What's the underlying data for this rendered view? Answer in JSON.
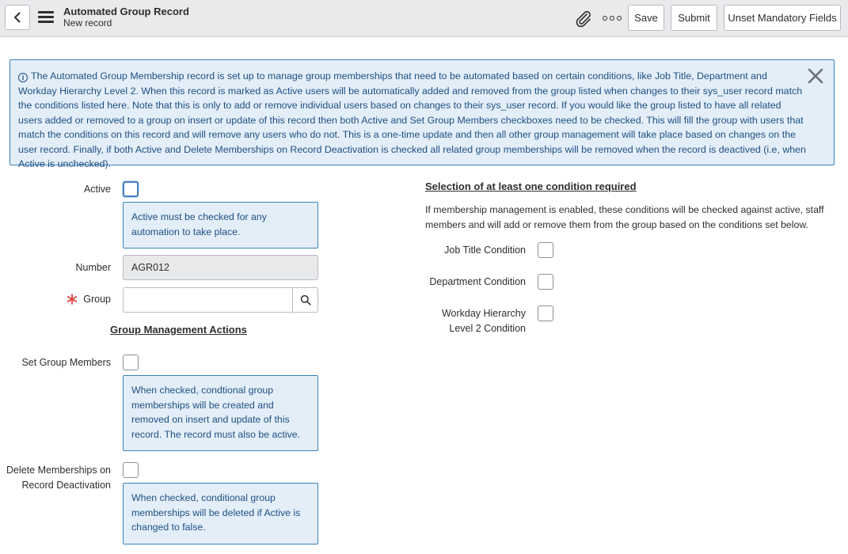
{
  "header": {
    "title": "Automated Group Record",
    "subtitle": "New record",
    "buttons": {
      "save": "Save",
      "submit": "Submit",
      "unset": "Unset Mandatory Fields"
    }
  },
  "banner": {
    "text": "The Automated Group Membership record is set up to manage group memberships that need to be automated based on certain conditions, like Job Title, Department and Workday Hierarchy Level 2. When this record is marked as Active users will be automatically added and removed from the group listed when changes to their sys_user record match the conditions listed here. Note that this is only to add or remove individual users based on changes to their sys_user record. If you would like the group listed to have all related users added or removed to a group on insert or update of this record then both Active and Set Group Members checkboxes need to be checked. This will fill the group with users that match the conditions on this record and will remove any users who do not. This is a one-time update and then all other group management will take place based on changes on the user record. Finally, if both Active and Delete Memberships on Record Deactivation is checked all related group memberships will be removed when the record is deactived (i.e, when Active is unchecked)."
  },
  "form": {
    "active": {
      "label": "Active",
      "checked": false,
      "note": "Active must be checked for any automation to take place."
    },
    "number": {
      "label": "Number",
      "value": "AGR012"
    },
    "group": {
      "label": "Group",
      "value": "",
      "required": true
    },
    "group_actions_heading": "Group Management Actions",
    "set_group_members": {
      "label": "Set Group Members",
      "checked": false,
      "note": "When checked, condtional group memberships will be created and removed on insert and update of this record. The record must also be active."
    },
    "delete_memberships": {
      "label_line1": "Delete Memberships on",
      "label_line2": "Record Deactivation",
      "checked": false,
      "note": "When checked, conditional group memberships will be deleted if Active is changed to false."
    }
  },
  "conditions": {
    "heading": "Selection of at least one condition required",
    "description": "If membership management is enabled, these conditions will be checked against active, staff members and will add or remove them from the group based on the conditions set below.",
    "job_title": {
      "label": "Job Title Condition",
      "checked": false
    },
    "department": {
      "label": "Department Condition",
      "checked": false
    },
    "workday": {
      "label_line1": "Workday Hierarchy",
      "label_line2": "Level 2 Condition",
      "checked": false
    }
  },
  "icons": [
    "back-icon",
    "menu-icon",
    "paperclip-icon",
    "more-icon",
    "info-icon",
    "close-icon",
    "search-icon",
    "required-icon"
  ],
  "colors": {
    "info_bg": "#e3eef8",
    "info_border": "#3a82b8",
    "info_text": "#1f4f82",
    "required": "#e0413a"
  }
}
